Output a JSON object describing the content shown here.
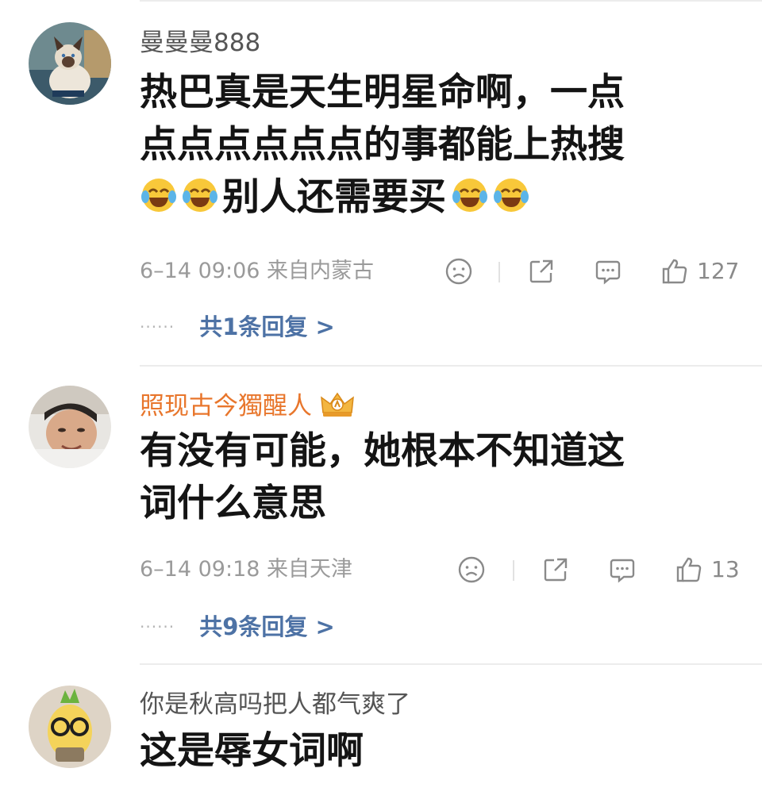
{
  "comments": [
    {
      "username": "曼曼曼888",
      "content_lines": [
        "热巴真是天生明星命啊，一点",
        "点点点点点点的事都能上热搜"
      ],
      "content_line3_text": "别人还需要买",
      "emoji_name": "laugh-cry-emoji",
      "meta": "6–14 09:06 来自内蒙古",
      "like_count": "127",
      "replies": "共1条回复 >"
    },
    {
      "username": "照现古今獨醒人",
      "vip_badge": "crown-icon",
      "content_lines": [
        "有没有可能，她根本不知道这",
        "词什么意思"
      ],
      "meta": "6–14 09:18 来自天津",
      "like_count": "13",
      "replies": "共9条回复 >"
    },
    {
      "username": "你是秋高吗把人都气爽了",
      "content_lines": [
        "这是辱女词啊"
      ]
    }
  ],
  "reply_dots": "······",
  "colors": {
    "vip_name": "#e8762c",
    "reply_link": "#4d72a5",
    "meta_gray": "#9a9a9a",
    "content": "#141414"
  }
}
